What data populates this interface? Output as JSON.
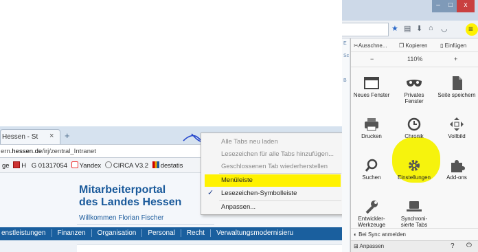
{
  "left_window": {
    "tab_title": "Hessen - St",
    "tab_close": "×",
    "new_tab": "+",
    "url": {
      "prefix": "ern.",
      "host": "hessen.de",
      "path": "/irj/zentral_Intranet"
    },
    "bookmarks": [
      "ge",
      "H",
      "G 01317054",
      "Yandex",
      "CIRCA V3.2",
      "destatis"
    ],
    "portal": {
      "title_line1": "Mitarbeiterportal",
      "title_line2": "des Landes Hessen",
      "welcome": "Willkommen Florian Fischer"
    },
    "nav": [
      "enstleistungen",
      "Finanzen",
      "Organisation",
      "Personal",
      "Recht",
      "Verwaltungsmodernisieru"
    ]
  },
  "context_menu": {
    "items": [
      {
        "label": "Alle Tabs neu laden",
        "disabled": true
      },
      {
        "label": "Lesezeichen für alle Tabs hinzufügen...",
        "disabled": true
      },
      {
        "label": "Geschlossenen Tab wiederherstellen",
        "disabled": true
      },
      {
        "label": "Menüleiste",
        "disabled": false,
        "highlighted": true
      },
      {
        "label": "Lesezeichen-Symbolleiste",
        "disabled": false,
        "checked": true
      },
      {
        "label": "Anpassen...",
        "disabled": false
      }
    ],
    "check_mark": "✓"
  },
  "firefox": {
    "window_buttons": {
      "minimize": "–",
      "maximize": "□",
      "close": "x"
    },
    "edit": {
      "cut": "Ausschne...",
      "copy": "Kopieren",
      "paste": "Einfügen"
    },
    "zoom": {
      "minus": "−",
      "level": "110%",
      "plus": "+"
    },
    "tiles": [
      {
        "label": "Neues Fenster",
        "icon": "window-icon"
      },
      {
        "label": "Privates Fenster",
        "icon": "mask-icon"
      },
      {
        "label": "Seite speichern",
        "icon": "page-icon"
      },
      {
        "label": "Drucken",
        "icon": "printer-icon"
      },
      {
        "label": "Chronik",
        "icon": "clock-icon"
      },
      {
        "label": "Vollbild",
        "icon": "fullscreen-icon"
      },
      {
        "label": "Suchen",
        "icon": "search-icon"
      },
      {
        "label": "Einstellungen",
        "icon": "gear-icon"
      },
      {
        "label": "Add-ons",
        "icon": "puzzle-icon"
      },
      {
        "label": "Entwickler-Werkzeuge",
        "icon": "wrench-icon"
      },
      {
        "label": "Synchroni-sierte Tabs",
        "icon": "sync-tabs-icon"
      }
    ],
    "sync": "Bei Sync anmelden",
    "customize": "Anpassen",
    "strip_text": [
      "E",
      "Sc",
      "B"
    ]
  },
  "colors": {
    "highlight_yellow": "#fff200",
    "portal_blue": "#1a5a9b",
    "nav_blue": "#1a5f9e"
  }
}
